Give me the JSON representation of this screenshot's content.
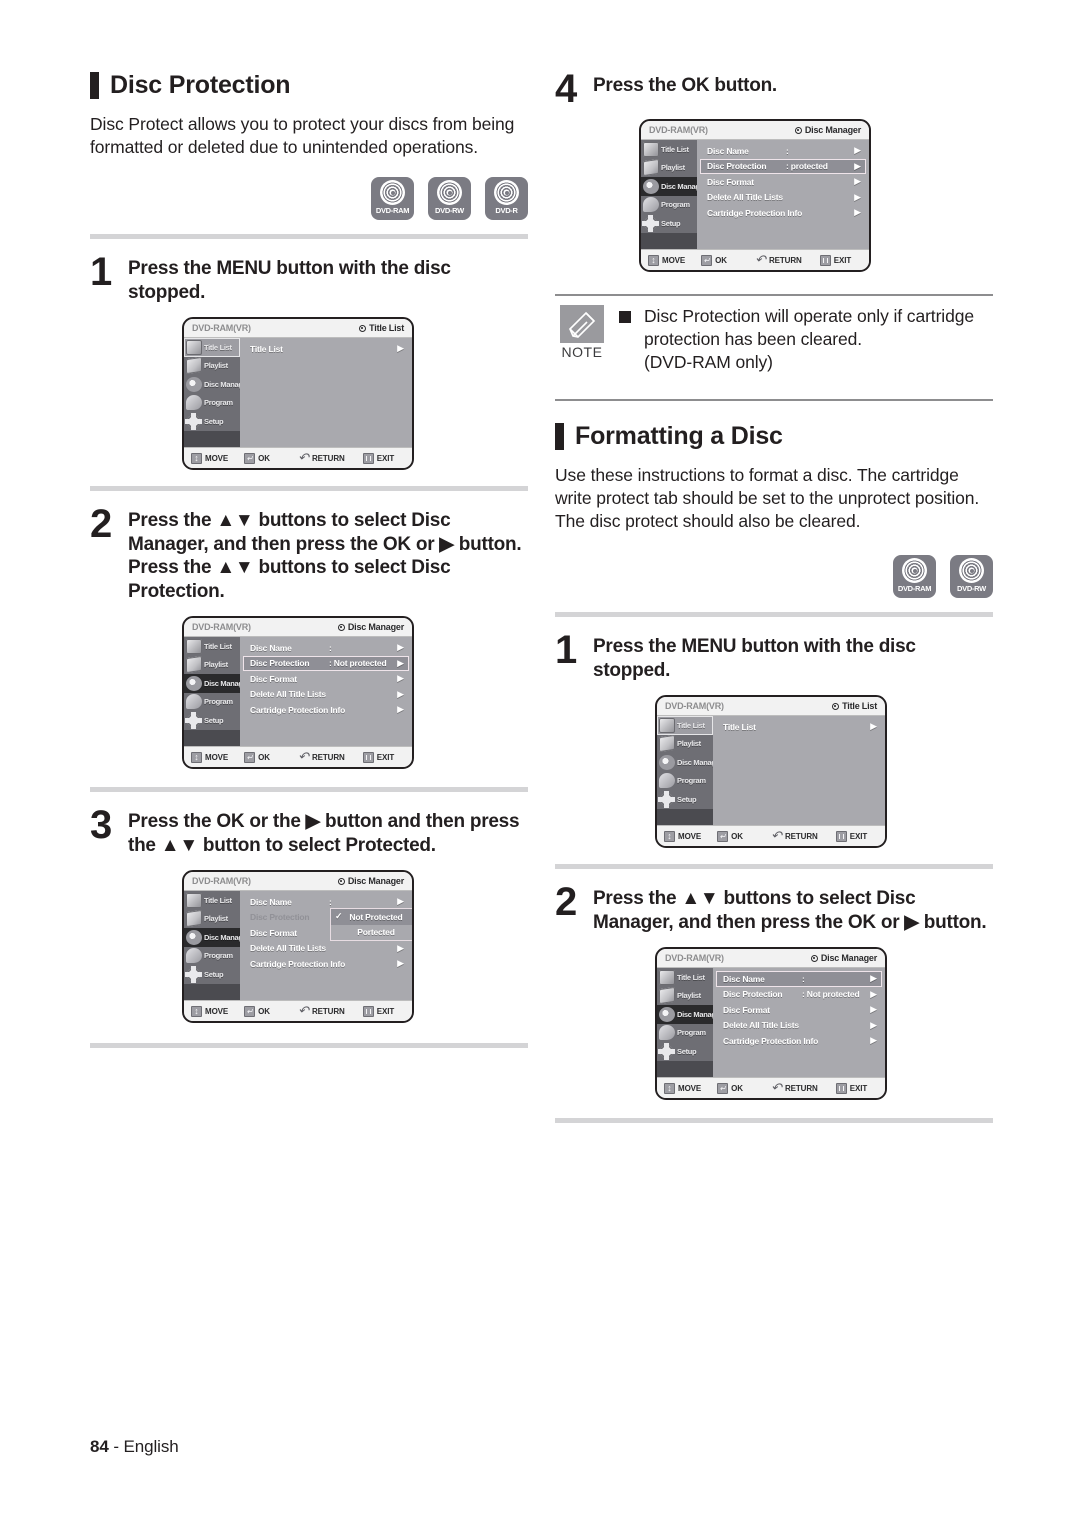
{
  "page": {
    "number": "84",
    "dash": " - ",
    "language": "English"
  },
  "left": {
    "section": {
      "title": "Disc Protection"
    },
    "intro": "Disc Protect allows you to protect your discs from being formatted or deleted due to unintended operations.",
    "media_icons": [
      {
        "label": "DVD-RAM"
      },
      {
        "label": "DVD-RW"
      },
      {
        "label": "DVD-R"
      }
    ],
    "steps": [
      {
        "num": "1",
        "text": "Press the MENU button with the disc stopped."
      },
      {
        "num": "2",
        "text": "Press the ▲▼ buttons to select Disc Manager, and then press the OK or ▶ button.\nPress the ▲▼ buttons to select Disc Protection."
      },
      {
        "num": "3",
        "text": "Press the OK or the ▶ button and then press the ▲▼ button to select Protected."
      }
    ]
  },
  "right": {
    "step4": {
      "num": "4",
      "text": "Press the OK button."
    },
    "note": {
      "icon_label": "NOTE",
      "text": "Disc Protection will operate only if cartridge protection has been cleared.\n(DVD-RAM only)"
    },
    "section": {
      "title": "Formatting a Disc"
    },
    "intro": "Use these instructions to format a disc. The cartridge write protect tab should be set to the unprotect position. The disc protect should also be cleared.",
    "media_icons": [
      {
        "label": "DVD-RAM"
      },
      {
        "label": "DVD-RW"
      }
    ],
    "steps": [
      {
        "num": "1",
        "text": "Press the MENU button with the disc stopped."
      },
      {
        "num": "2",
        "text": "Press the ▲▼ buttons to select Disc Manager, and then press the OK or ▶ button."
      }
    ]
  },
  "osd": {
    "disc_label": "DVD-RAM(VR)",
    "sidebar": [
      {
        "name": "Title List"
      },
      {
        "name": "Playlist"
      },
      {
        "name": "Disc Manager"
      },
      {
        "name": "Program"
      },
      {
        "name": "Setup"
      }
    ],
    "footer": [
      {
        "label": "MOVE"
      },
      {
        "label": "OK"
      },
      {
        "label": "RETURN"
      },
      {
        "label": "EXIT"
      }
    ],
    "screens": {
      "title_list": {
        "target": "Title List",
        "rows": [
          {
            "label": "Title List",
            "value": "",
            "arrow": "▶"
          }
        ]
      },
      "disc_manager_not_protected": {
        "target": "Disc Manager",
        "rows": [
          {
            "label": "Disc Name",
            "value": ":",
            "arrow": "▶"
          },
          {
            "label": "Disc Protection",
            "value": ": Not protected",
            "arrow": "▶"
          },
          {
            "label": "Disc Format",
            "value": "",
            "arrow": "▶"
          },
          {
            "label": "Delete All Title Lists",
            "value": "",
            "arrow": "▶"
          },
          {
            "label": "Cartridge Protection Info",
            "value": "",
            "arrow": "▶"
          }
        ]
      },
      "disc_manager_dropdown": {
        "target": "Disc Manager",
        "rows": [
          {
            "label": "Disc Name",
            "value": ":",
            "arrow": "▶"
          },
          {
            "label": "Disc Protection",
            "value": "",
            "arrow": ""
          },
          {
            "label": "Disc Format",
            "value": "",
            "arrow": ""
          },
          {
            "label": "Delete All Title Lists",
            "value": "",
            "arrow": "▶"
          },
          {
            "label": "Cartridge Protection Info",
            "value": "",
            "arrow": "▶"
          }
        ],
        "dropdown": {
          "check": "✓",
          "options": [
            {
              "label": "Not Protected"
            },
            {
              "label": "Portected"
            }
          ]
        }
      },
      "disc_manager_protected": {
        "target": "Disc Manager",
        "rows": [
          {
            "label": "Disc Name",
            "value": ":",
            "arrow": "▶"
          },
          {
            "label": "Disc Protection",
            "value": ": protected",
            "arrow": "▶"
          },
          {
            "label": "Disc Format",
            "value": "",
            "arrow": "▶"
          },
          {
            "label": "Delete All Title Lists",
            "value": "",
            "arrow": "▶"
          },
          {
            "label": "Cartridge Protection Info",
            "value": "",
            "arrow": "▶"
          }
        ]
      },
      "disc_manager_discname_sel": {
        "target": "Disc Manager",
        "rows": [
          {
            "label": "Disc Name",
            "value": ":",
            "arrow": "▶"
          },
          {
            "label": "Disc Protection",
            "value": ": Not protected",
            "arrow": "▶"
          },
          {
            "label": "Disc Format",
            "value": "",
            "arrow": "▶"
          },
          {
            "label": "Delete All Title Lists",
            "value": "",
            "arrow": "▶"
          },
          {
            "label": "Cartridge Protection Info",
            "value": "",
            "arrow": "▶"
          }
        ]
      }
    }
  }
}
